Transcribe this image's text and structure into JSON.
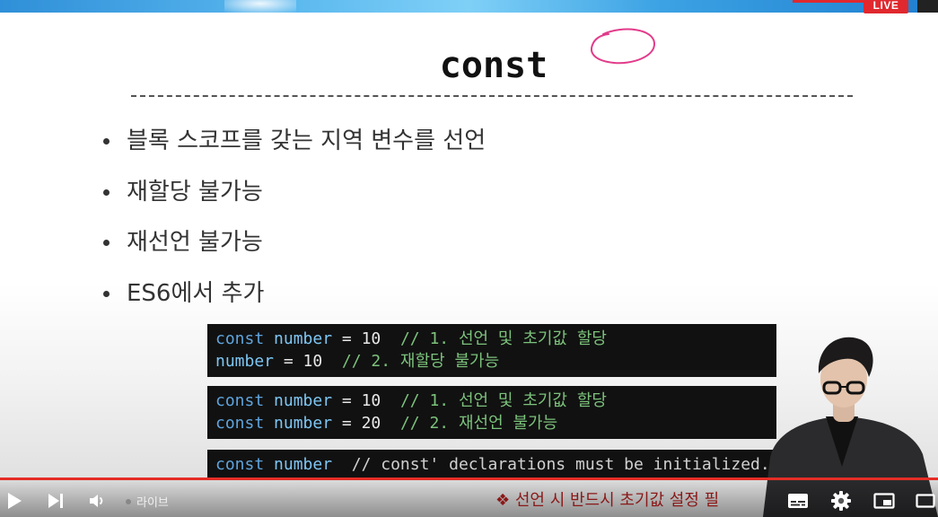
{
  "player": {
    "live_badge": "LIVE",
    "live_label": "라이브",
    "subtitle": "❖ 선언 시 반드시 초기값 설정 필",
    "accent_color": "#e52d27"
  },
  "slide": {
    "title": "const",
    "bullets": [
      "블록 스코프를 갖는 지역 변수를 선언",
      "재할당 불가능",
      "재선언 불가능",
      "ES6에서 추가"
    ],
    "code_blocks": [
      {
        "lines": [
          {
            "kw": "const",
            "var": "number",
            "op": " = ",
            "num": "10",
            "comment": "  // 1. 선언 및 초기값 할당"
          },
          {
            "kw": "",
            "var": "number",
            "op": " = ",
            "num": "10",
            "comment": "  // 2. 재할당 불가능"
          }
        ]
      },
      {
        "lines": [
          {
            "kw": "const",
            "var": "number",
            "op": " = ",
            "num": "10",
            "comment": "  // 1. 선언 및 초기값 할당"
          },
          {
            "kw": "const",
            "var": "number",
            "op": " = ",
            "num": "20",
            "comment": "  // 2. 재선언 불가능"
          }
        ]
      },
      {
        "lines": [
          {
            "kw": "const",
            "var": "number",
            "op": "",
            "num": "",
            "comment": "  // const' declarations must be initialized."
          }
        ]
      }
    ]
  },
  "icons": {
    "play": "play-icon",
    "next": "skip-next-icon",
    "volume": "volume-icon",
    "captions": "subtitles-icon",
    "settings": "gear-icon",
    "miniplayer": "miniplayer-icon",
    "theater": "theater-mode-icon"
  }
}
